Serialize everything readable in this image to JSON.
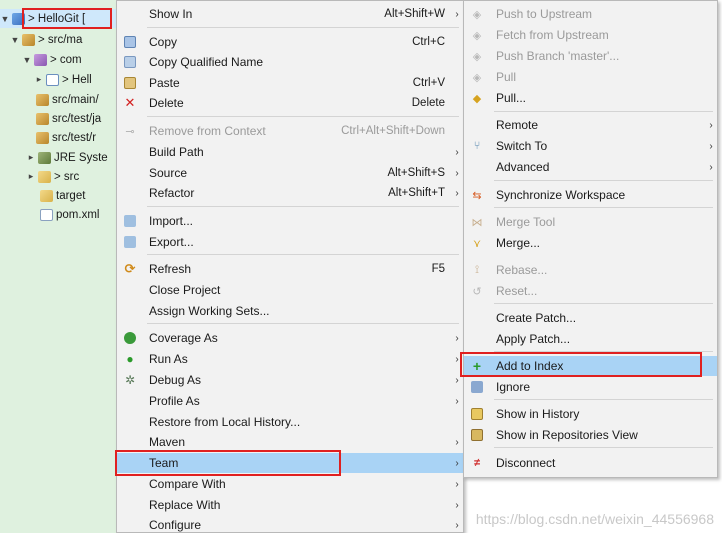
{
  "tree": {
    "project": "> HelloGit [",
    "src_main": "> src/ma",
    "com": "> com",
    "hello": "> Hell",
    "src_main_res": "src/main/",
    "src_test_ja": "src/test/ja",
    "src_test_r": "src/test/r",
    "jre": "JRE Syste",
    "src": "> src",
    "target": "target",
    "pom": "pom.xml"
  },
  "main_menu": {
    "items": [
      {
        "label": "Show In",
        "accel": "Alt+Shift+W",
        "sub": "›"
      },
      {
        "label": "Copy",
        "accel": "Ctrl+C"
      },
      {
        "label": "Copy Qualified Name"
      },
      {
        "label": "Paste",
        "accel": "Ctrl+V"
      },
      {
        "label": "Delete",
        "accel": "Delete"
      },
      {
        "label": "Remove from Context",
        "accel": "Ctrl+Alt+Shift+Down"
      },
      {
        "label": "Build Path",
        "sub": "›"
      },
      {
        "label": "Source",
        "accel": "Alt+Shift+S",
        "sub": "›"
      },
      {
        "label": "Refactor",
        "accel": "Alt+Shift+T",
        "sub": "›"
      },
      {
        "label": "Import..."
      },
      {
        "label": "Export..."
      },
      {
        "label": "Refresh",
        "accel": "F5"
      },
      {
        "label": "Close Project"
      },
      {
        "label": "Assign Working Sets..."
      },
      {
        "label": "Coverage As",
        "sub": "›"
      },
      {
        "label": "Run As",
        "sub": "›"
      },
      {
        "label": "Debug As",
        "sub": "›"
      },
      {
        "label": "Profile As",
        "sub": "›"
      },
      {
        "label": "Restore from Local History..."
      },
      {
        "label": "Maven",
        "sub": "›"
      },
      {
        "label": "Team",
        "sub": "›"
      },
      {
        "label": "Compare With",
        "sub": "›"
      },
      {
        "label": "Replace With",
        "sub": "›"
      },
      {
        "label": "Configure",
        "sub": "›"
      }
    ]
  },
  "team_menu": {
    "items": [
      {
        "label": "Push to Upstream"
      },
      {
        "label": "Fetch from Upstream"
      },
      {
        "label": "Push Branch 'master'..."
      },
      {
        "label": "Pull"
      },
      {
        "label": "Pull..."
      },
      {
        "label": "Remote",
        "sub": "›"
      },
      {
        "label": "Switch To",
        "sub": "›"
      },
      {
        "label": "Advanced",
        "sub": "›"
      },
      {
        "label": "Synchronize Workspace"
      },
      {
        "label": "Merge Tool"
      },
      {
        "label": "Merge..."
      },
      {
        "label": "Rebase..."
      },
      {
        "label": "Reset..."
      },
      {
        "label": "Create Patch..."
      },
      {
        "label": "Apply Patch..."
      },
      {
        "label": "Add to Index"
      },
      {
        "label": "Ignore"
      },
      {
        "label": "Show in History"
      },
      {
        "label": "Show in Repositories View"
      },
      {
        "label": "Disconnect"
      }
    ]
  },
  "watermark": "https://blog.csdn.net/weixin_44556968"
}
